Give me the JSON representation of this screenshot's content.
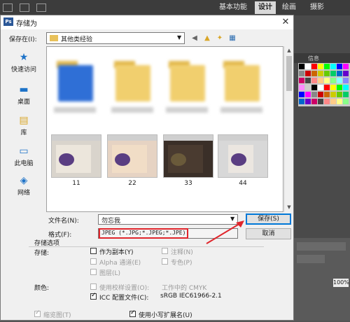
{
  "photoshop": {
    "workspace_tabs": [
      {
        "label": "基本功能",
        "active": false
      },
      {
        "label": "设计",
        "active": true
      },
      {
        "label": "绘画",
        "active": false
      },
      {
        "label": "摄影",
        "active": false
      }
    ],
    "panel_tab_label": "信息",
    "bottom_value": "100%"
  },
  "dialog": {
    "app_badge": "Ps",
    "title": "存储为",
    "save_in_label": "保存在(I):",
    "save_in_value": "其他类经验",
    "places": [
      {
        "label": "快速访问",
        "icon": "star-icon"
      },
      {
        "label": "桌面",
        "icon": "desktop-icon"
      },
      {
        "label": "库",
        "icon": "library-icon"
      },
      {
        "label": "此电脑",
        "icon": "computer-icon"
      },
      {
        "label": "网络",
        "icon": "network-icon"
      }
    ],
    "thumbnails": [
      {
        "caption": "11"
      },
      {
        "caption": "22"
      },
      {
        "caption": "33"
      },
      {
        "caption": "44"
      }
    ],
    "filename_label": "文件名(N):",
    "filename_value": "勿忘我",
    "format_label": "格式(F):",
    "format_value": "JPEG (*.JPG;*.JPEG;*.JPE)",
    "save_button": "保存(S)",
    "cancel_button": "取消",
    "options": {
      "group_title": "存储选项",
      "store_label": "存储:",
      "as_copy": "作为副本(Y)",
      "alpha": "Alpha 通道(E)",
      "layers": "图层(L)",
      "notes": "注释(N)",
      "spot": "专色(P)",
      "color_label": "颜色:",
      "proof_setup": "使用校样设置(O):",
      "proof_value": "工作中的 CMYK",
      "icc": "ICC 配置文件(C):",
      "icc_value": "sRGB IEC61966-2.1",
      "thumbnail": "缩览图(T)",
      "lowercase_ext": "使用小写扩展名(U)"
    }
  }
}
